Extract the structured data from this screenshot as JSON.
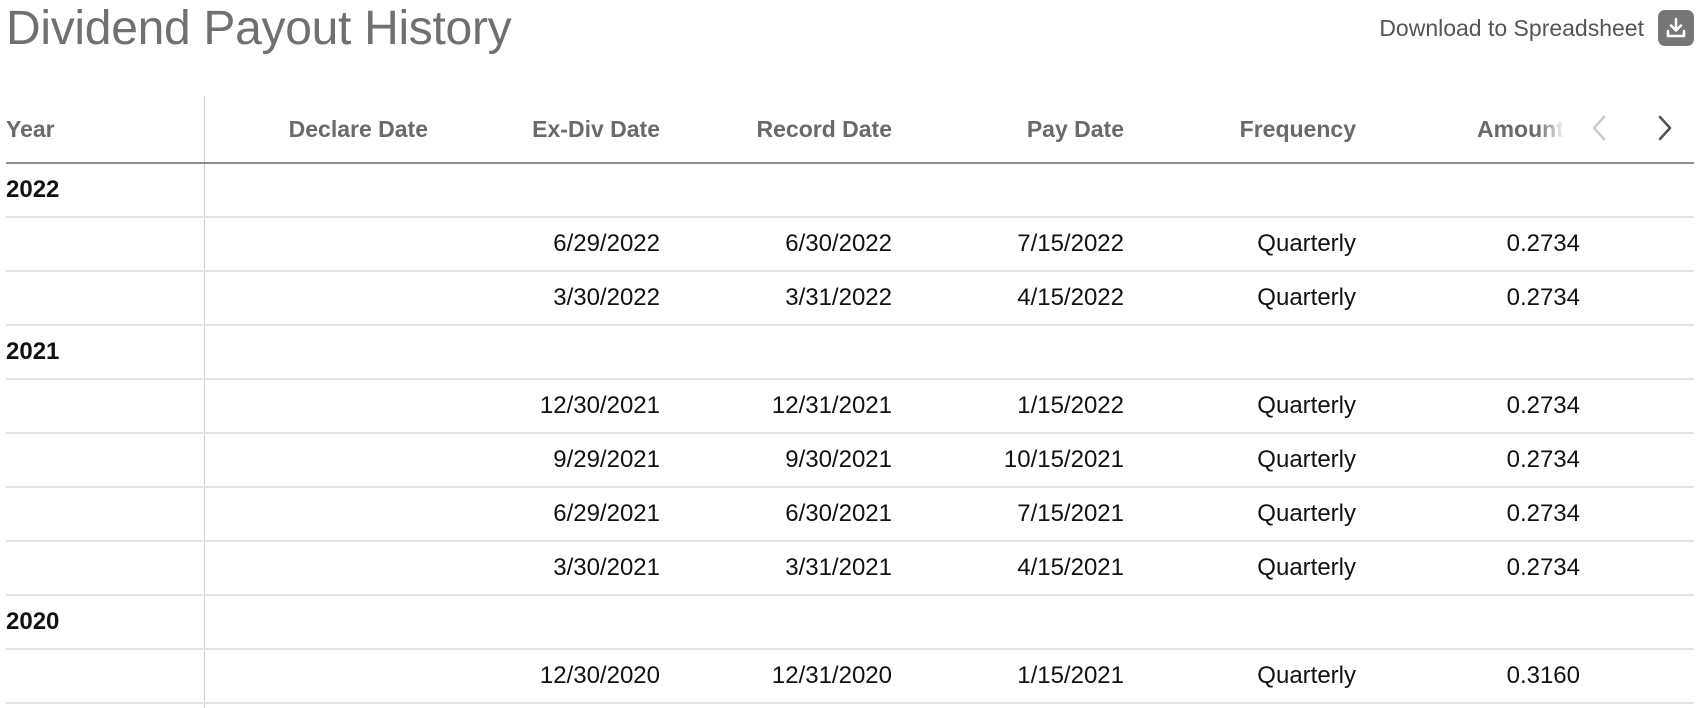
{
  "header": {
    "title": "Dividend Payout History",
    "download_label": "Download to Spreadsheet"
  },
  "table": {
    "columns": {
      "year": "Year",
      "declare_date": "Declare Date",
      "ex_div_date": "Ex-Div Date",
      "record_date": "Record Date",
      "pay_date": "Pay Date",
      "frequency": "Frequency",
      "amount": "Amount"
    },
    "groups": [
      {
        "year": "2022",
        "rows": [
          {
            "declare_date": "",
            "ex_div_date": "6/29/2022",
            "record_date": "6/30/2022",
            "pay_date": "7/15/2022",
            "frequency": "Quarterly",
            "amount": "0.2734"
          },
          {
            "declare_date": "",
            "ex_div_date": "3/30/2022",
            "record_date": "3/31/2022",
            "pay_date": "4/15/2022",
            "frequency": "Quarterly",
            "amount": "0.2734"
          }
        ]
      },
      {
        "year": "2021",
        "rows": [
          {
            "declare_date": "",
            "ex_div_date": "12/30/2021",
            "record_date": "12/31/2021",
            "pay_date": "1/15/2022",
            "frequency": "Quarterly",
            "amount": "0.2734"
          },
          {
            "declare_date": "",
            "ex_div_date": "9/29/2021",
            "record_date": "9/30/2021",
            "pay_date": "10/15/2021",
            "frequency": "Quarterly",
            "amount": "0.2734"
          },
          {
            "declare_date": "",
            "ex_div_date": "6/29/2021",
            "record_date": "6/30/2021",
            "pay_date": "7/15/2021",
            "frequency": "Quarterly",
            "amount": "0.2734"
          },
          {
            "declare_date": "",
            "ex_div_date": "3/30/2021",
            "record_date": "3/31/2021",
            "pay_date": "4/15/2021",
            "frequency": "Quarterly",
            "amount": "0.2734"
          }
        ]
      },
      {
        "year": "2020",
        "rows": [
          {
            "declare_date": "",
            "ex_div_date": "12/30/2020",
            "record_date": "12/31/2020",
            "pay_date": "1/15/2021",
            "frequency": "Quarterly",
            "amount": "0.3160"
          }
        ]
      }
    ]
  },
  "icons": {
    "download": "download-icon",
    "prev": "chevron-left-icon",
    "next": "chevron-right-icon"
  },
  "colors": {
    "title": "#707070",
    "download_icon_bg": "#767676",
    "header_text": "#6a6a6a",
    "nav_prev_disabled": "#cccccc",
    "nav_next": "#555555"
  }
}
